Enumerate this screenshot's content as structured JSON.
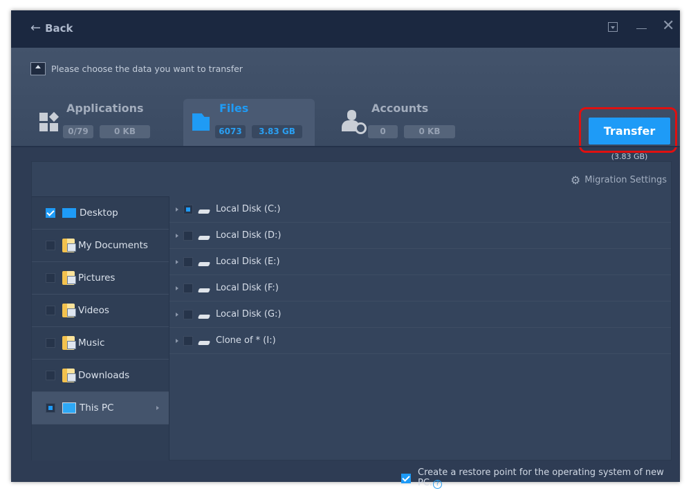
{
  "titlebar": {
    "back_label": "Back"
  },
  "header": {
    "prompt": "Please choose the data you want to transfer",
    "tabs": [
      {
        "label": "Applications",
        "count": "0/79",
        "size": "0 KB",
        "icon": "apps-grid-icon",
        "active": false
      },
      {
        "label": "Files",
        "count": "6073",
        "size": "3.83 GB",
        "icon": "folder-icon",
        "active": true
      },
      {
        "label": "Accounts",
        "count": "0",
        "size": "0 KB",
        "icon": "user-gear-icon",
        "active": false
      }
    ],
    "transfer_label": "Transfer",
    "transfer_size": "(3.83 GB)"
  },
  "panel": {
    "migration_settings": "Migration Settings",
    "folders": [
      {
        "label": "Desktop",
        "state": "checked"
      },
      {
        "label": "My Documents",
        "state": "unchecked"
      },
      {
        "label": "Pictures",
        "state": "unchecked"
      },
      {
        "label": "Videos",
        "state": "unchecked"
      },
      {
        "label": "Music",
        "state": "unchecked"
      },
      {
        "label": "Downloads",
        "state": "unchecked"
      },
      {
        "label": "This PC",
        "state": "partial",
        "selected": true
      }
    ],
    "drives": [
      {
        "label": "Local Disk (C:)",
        "state": "partial"
      },
      {
        "label": "Local Disk (D:)",
        "state": "unchecked"
      },
      {
        "label": "Local Disk (E:)",
        "state": "unchecked"
      },
      {
        "label": "Local Disk (F:)",
        "state": "unchecked"
      },
      {
        "label": "Local Disk (G:)",
        "state": "unchecked"
      },
      {
        "label": "Clone of * (I:)",
        "state": "unchecked"
      }
    ]
  },
  "footer": {
    "restore_label": "Create a restore point for the operating system of new PC.",
    "restore_checked": true,
    "help": "?"
  },
  "colors": {
    "accent": "#1e9bf7",
    "highlight": "#e01010",
    "titlebar": "#1b2840"
  }
}
